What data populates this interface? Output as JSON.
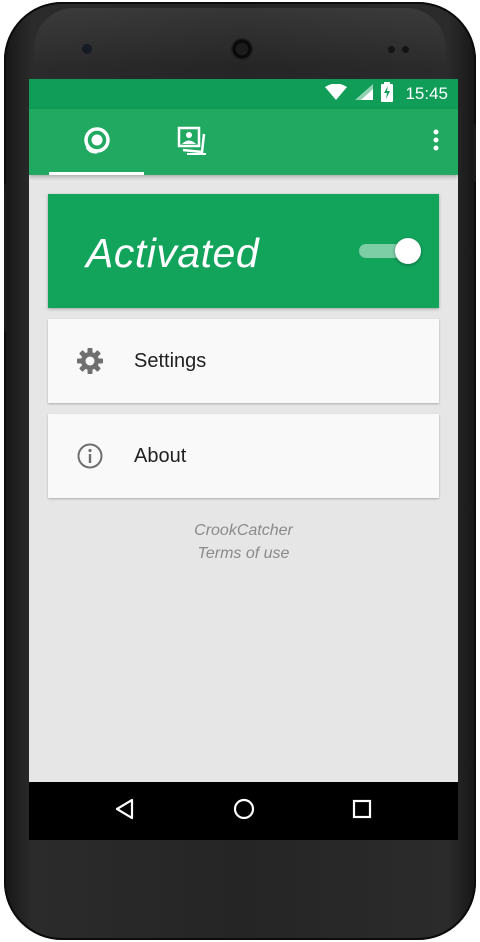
{
  "status_bar": {
    "time": "15:45",
    "icons": [
      "wifi-icon",
      "cell-signal-icon",
      "battery-charging-icon"
    ]
  },
  "toolbar": {
    "tabs": [
      {
        "icon": "camera-lens-icon",
        "selected": true
      },
      {
        "icon": "photo-gallery-icon",
        "selected": false
      }
    ],
    "overflow_icon": "more-vert-icon"
  },
  "activation": {
    "label": "Activated",
    "enabled": true
  },
  "menu": {
    "items": [
      {
        "label": "Settings",
        "icon": "gear-icon"
      },
      {
        "label": "About",
        "icon": "info-icon"
      }
    ]
  },
  "footer": {
    "app_name": "CrookCatcher",
    "terms": "Terms of use"
  },
  "nav_bar": {
    "buttons": [
      "back-icon",
      "home-icon",
      "recents-icon"
    ]
  },
  "colors": {
    "status_bar": "#0f9d58",
    "toolbar": "#21a861",
    "activated_card": "#13a45c",
    "background": "#e6e6e6",
    "card": "#f9f9f9"
  }
}
